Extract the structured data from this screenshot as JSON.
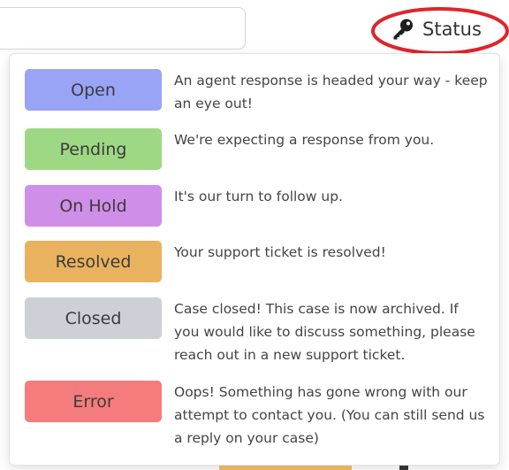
{
  "header": {
    "status_label": "Status",
    "status_icon": "key-icon"
  },
  "colors": {
    "highlight_ring": "#e0242b",
    "open": "#99a4f7",
    "pending": "#9ed884",
    "on_hold": "#cf8ee8",
    "resolved": "#e9b25e",
    "closed": "#cdd0d6",
    "error": "#f57c7c"
  },
  "legend": [
    {
      "label": "Open",
      "description": "An agent response is headed your way - keep an eye out!"
    },
    {
      "label": "Pending",
      "description": "We're expecting a response from you."
    },
    {
      "label": "On Hold",
      "description": "It's our turn to follow up."
    },
    {
      "label": "Resolved",
      "description": "Your support ticket is resolved!"
    },
    {
      "label": "Closed",
      "description": "Case closed! This case is now archived. If you would like to discuss something, please reach out in a new support ticket."
    },
    {
      "label": "Error",
      "description": "Oops! Something has gone wrong with our attempt to contact you. (You can still send us a reply on your case)"
    }
  ]
}
